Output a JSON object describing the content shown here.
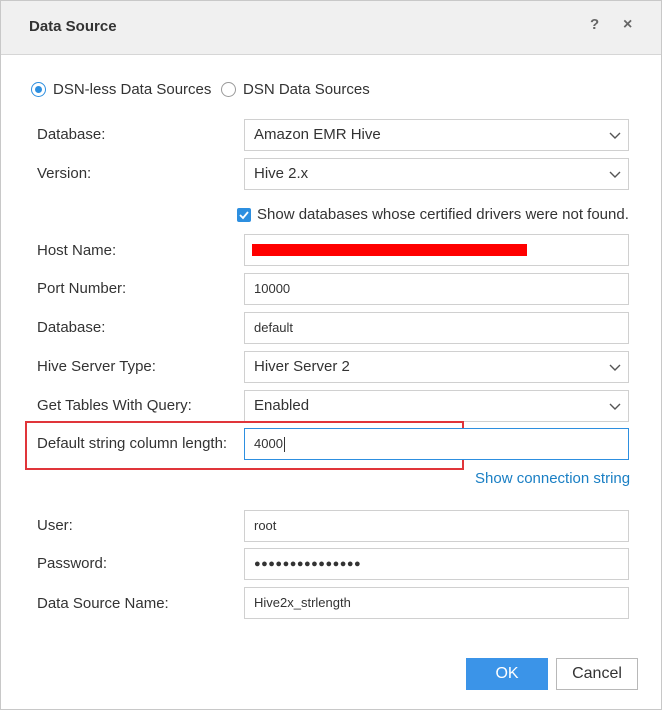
{
  "dialog": {
    "title": "Data Source",
    "help_label": "?",
    "close_label": "×"
  },
  "source_type": {
    "options": [
      {
        "label": "DSN-less Data Sources",
        "selected": true
      },
      {
        "label": "DSN Data Sources",
        "selected": false
      }
    ]
  },
  "form": {
    "database_type": {
      "label": "Database:",
      "value": "Amazon EMR Hive"
    },
    "version": {
      "label": "Version:",
      "value": "Hive 2.x"
    },
    "show_uncertified": {
      "label": "Show databases whose certified drivers were not found.",
      "checked": true
    },
    "host_name": {
      "label": "Host Name:",
      "value": ""
    },
    "port_number": {
      "label": "Port Number:",
      "value": "10000"
    },
    "database": {
      "label": "Database:",
      "value": "default"
    },
    "hive_server_type": {
      "label": "Hive Server Type:",
      "value": "Hiver Server 2"
    },
    "get_tables_with_query": {
      "label": "Get Tables With Query:",
      "value": "Enabled"
    },
    "default_string_length": {
      "label": "Default string column length:",
      "value": "4000"
    },
    "show_connection_string": "Show connection string",
    "user": {
      "label": "User:",
      "value": "root"
    },
    "password": {
      "label": "Password:",
      "value": "●●●●●●●●●●●●●●●"
    },
    "data_source_name": {
      "label": "Data Source Name:",
      "value": "Hive2x_strlength"
    }
  },
  "buttons": {
    "ok": "OK",
    "cancel": "Cancel"
  },
  "colors": {
    "accent": "#2d8fe0",
    "ok_button": "#3b94e8",
    "link": "#1a7fc4",
    "highlight_box": "#e0353a",
    "redaction": "#ff0000"
  }
}
